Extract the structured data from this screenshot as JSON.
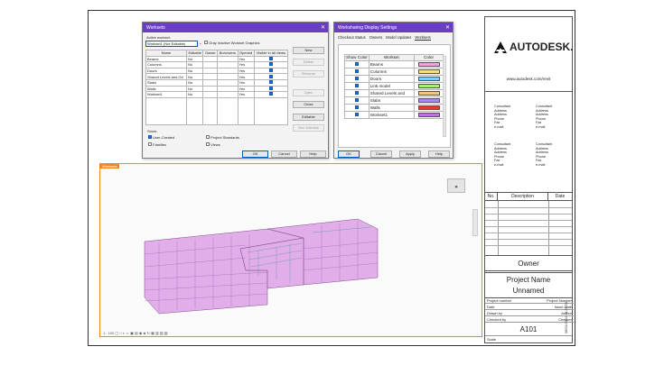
{
  "worksets_dialog": {
    "title": "Worksets",
    "active_label": "Active workset:",
    "active_value": "Workset1 (Not Editable)",
    "gray_label": "Gray Inactive Workset Graphics",
    "columns": [
      "Name",
      "Editable",
      "Owner",
      "Borrowers",
      "Opened",
      "Visible in all views"
    ],
    "rows": [
      {
        "name": "Beams",
        "editable": "No",
        "opened": "Yes"
      },
      {
        "name": "Columns",
        "editable": "No",
        "opened": "Yes"
      },
      {
        "name": "Doors",
        "editable": "No",
        "opened": "Yes"
      },
      {
        "name": "Shared Levels and Gri",
        "editable": "No",
        "opened": "Yes"
      },
      {
        "name": "Slabs",
        "editable": "No",
        "opened": "Yes"
      },
      {
        "name": "Walls",
        "editable": "No",
        "opened": "Yes"
      },
      {
        "name": "Workset1",
        "editable": "No",
        "opened": "Yes"
      }
    ],
    "side_buttons": [
      "New",
      "Delete",
      "Rename",
      "Open",
      "Close",
      "Editable",
      "Non Editable"
    ],
    "show_label": "Show:",
    "show_options": [
      "User-Created",
      "Families",
      "Project Standards",
      "Views"
    ],
    "ok": "OK",
    "cancel": "Cancel",
    "help": "Help"
  },
  "display_dialog": {
    "title": "Worksharing Display Settings",
    "tabs": [
      "Checkout Status",
      "Owners",
      "Model Updates",
      "Worksets"
    ],
    "columns": [
      "Show Color",
      "Workset",
      "Color"
    ],
    "rows": [
      {
        "name": "Beams",
        "color": "#f5a0e0"
      },
      {
        "name": "Columns",
        "color": "#f5e27a"
      },
      {
        "name": "Doors",
        "color": "#7ad0f5"
      },
      {
        "name": "Link model",
        "color": "#a3f07a"
      },
      {
        "name": "Shared Levels and",
        "color": "#f5c28a"
      },
      {
        "name": "Slabs",
        "color": "#a78af0"
      },
      {
        "name": "Walls",
        "color": "#e03a3a"
      },
      {
        "name": "Workset1",
        "color": "#c070e0"
      }
    ],
    "ok": "OK",
    "cancel": "Cancel",
    "apply": "Apply",
    "help": "Help"
  },
  "viewport": {
    "label": "Worksets",
    "bottom_bar": "1 : 100  ▢ ⌂ ◐ ☼ ▣ ▤ ◉ ◈ ↻ ▦ ▥ ▧ ▨"
  },
  "titleblock": {
    "brand": "AUTODESK.",
    "url": "www.autodesk.com/revit",
    "consultants": [
      [
        "Consultant",
        "Address",
        "Address",
        "Phone",
        "Fax",
        "e-mail"
      ],
      [
        "Consultant",
        "Address",
        "Address",
        "Phone",
        "Fax",
        "e-mail"
      ],
      [
        "Consultant",
        "Address",
        "Address",
        "Phone",
        "Fax",
        "e-mail"
      ],
      [
        "Consultant",
        "Address",
        "Address",
        "Phone",
        "Fax",
        "e-mail"
      ]
    ],
    "rev_headers": [
      "No.",
      "Description",
      "Date"
    ],
    "owner": "Owner",
    "project_name": "Project Name",
    "unnamed": "Unnamed",
    "info_rows": [
      [
        "Project number",
        "Project Number"
      ],
      [
        "Date",
        "Issue Date"
      ],
      [
        "Drawn by",
        "Author"
      ],
      [
        "Checked by",
        "Checker"
      ]
    ],
    "sheet_number": "A101",
    "scale_label": "Scale",
    "timestamp": "08/04/2024 14:25:28"
  },
  "colors": {
    "dialog_title": "#6a3ec2",
    "viewport_border": "#f08a1c",
    "building": "#d894e4"
  }
}
